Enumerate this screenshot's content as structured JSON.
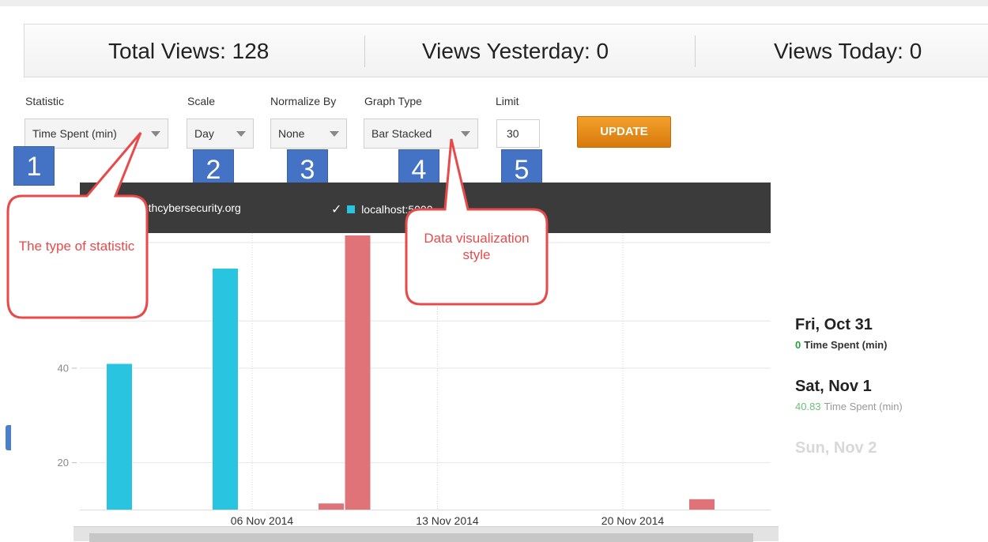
{
  "stats": {
    "total_views": "Total Views: 128",
    "views_yesterday": "Views Yesterday: 0",
    "views_today": "Views Today: 0"
  },
  "controls": {
    "statistic": {
      "label": "Statistic",
      "value": "Time Spent (min)"
    },
    "scale": {
      "label": "Scale",
      "value": "Day"
    },
    "normalize": {
      "label": "Normalize By",
      "value": "None"
    },
    "graph_type": {
      "label": "Graph Type",
      "value": "Bar Stacked"
    },
    "limit": {
      "label": "Limit",
      "value": "30"
    },
    "update_label": "UPDATE"
  },
  "badges": [
    "1",
    "2",
    "3",
    "4",
    "5"
  ],
  "callouts": {
    "statistic_note": "The type of statistic",
    "graph_type_note": "Data visualization style"
  },
  "legend": [
    {
      "label": "youthcybersecurity.org",
      "checked": true,
      "color": "#29c5e0"
    },
    {
      "label": "localhost:5000",
      "checked": true,
      "color": "#29c5e0"
    }
  ],
  "chart_data": {
    "type": "bar",
    "stacked": true,
    "y_ticks": [
      "20",
      "40"
    ],
    "x_ticks": [
      "06 Nov 2014",
      "13 Nov 2014",
      "20 Nov 2014"
    ],
    "ylim": [
      10,
      68
    ],
    "series": [
      {
        "color": "#29c5e0",
        "points": [
          {
            "date": "2014-11-01",
            "value": 40.83
          },
          {
            "date": "2014-11-05",
            "value": 61
          }
        ]
      },
      {
        "color": "#e07378",
        "points": [
          {
            "date": "2014-11-09",
            "value": 11.3
          },
          {
            "date": "2014-11-10",
            "value": 68
          },
          {
            "date": "2014-11-23",
            "value": 12.2
          }
        ]
      }
    ]
  },
  "tooltip": [
    {
      "day": "Fri, Oct 31",
      "value": "0",
      "unit": "Time Spent (min)",
      "value_color": "#2e9e3e"
    },
    {
      "day": "Sat, Nov 1",
      "value": "40.83",
      "unit": "Time Spent (min)",
      "value_color": "#6cc07a"
    },
    {
      "day": "Sun, Nov 2"
    }
  ]
}
